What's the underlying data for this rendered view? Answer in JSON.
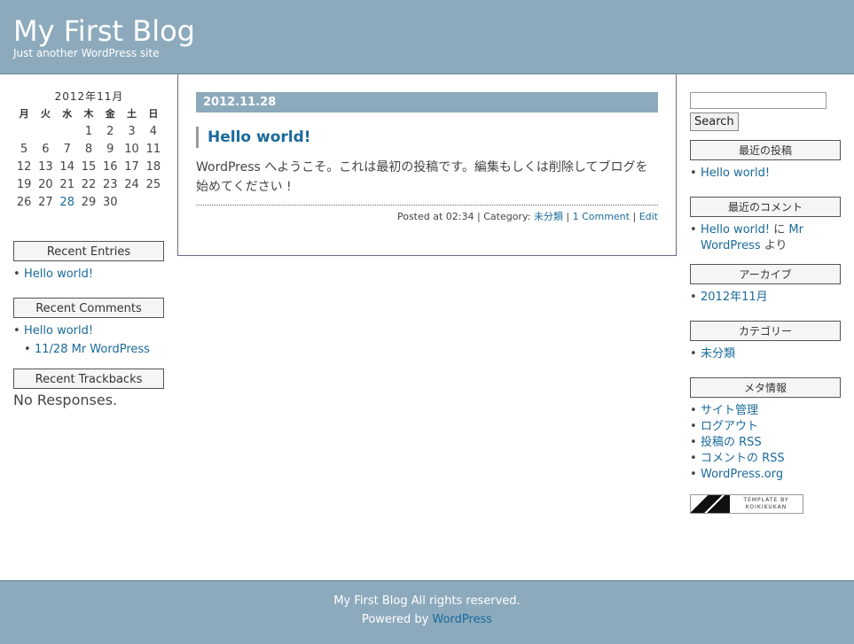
{
  "header": {
    "title": "My First Blog",
    "description": "Just another WordPress site"
  },
  "calendar": {
    "caption": "2012年11月",
    "weekdays": [
      "月",
      "火",
      "水",
      "木",
      "金",
      "土",
      "日"
    ],
    "weeks": [
      [
        "",
        "",
        "",
        "1",
        "2",
        "3",
        "4"
      ],
      [
        "5",
        "6",
        "7",
        "8",
        "9",
        "10",
        "11"
      ],
      [
        "12",
        "13",
        "14",
        "15",
        "16",
        "17",
        "18"
      ],
      [
        "19",
        "20",
        "21",
        "22",
        "23",
        "24",
        "25"
      ],
      [
        "26",
        "27",
        "28",
        "29",
        "30",
        "",
        ""
      ]
    ],
    "linked_day": "28"
  },
  "left_sidebar": {
    "recent_entries": {
      "title": "Recent Entries",
      "items": [
        "Hello world!"
      ]
    },
    "recent_comments": {
      "title": "Recent Comments",
      "post": "Hello world!",
      "sub": "11/28 Mr WordPress"
    },
    "recent_trackbacks": {
      "title": "Recent Trackbacks",
      "text": "No Responses."
    }
  },
  "post": {
    "date": "2012.11.28",
    "title": "Hello world!",
    "body": "WordPress へようこそ。これは最初の投稿です。編集もしくは削除してブログを始めてください !",
    "meta": {
      "posted_at": "Posted at 02:34",
      "category_label": "Category:",
      "category": "未分類",
      "comments": "1 Comment",
      "edit": "Edit",
      "sep": "|"
    }
  },
  "right_sidebar": {
    "search": {
      "placeholder": "",
      "button": "Search"
    },
    "recent_posts": {
      "title": "最近の投稿",
      "items": [
        "Hello world!"
      ]
    },
    "recent_comments": {
      "title": "最近のコメント",
      "link1": "Hello world!",
      "connector": " に ",
      "link2": "Mr WordPress",
      "suffix": " より"
    },
    "archives": {
      "title": "アーカイブ",
      "items": [
        "2012年11月"
      ]
    },
    "categories": {
      "title": "カテゴリー",
      "items": [
        "未分類"
      ]
    },
    "meta": {
      "title": "メタ情報",
      "items": [
        "サイト管理",
        "ログアウト",
        "投稿の RSS",
        "コメントの RSS",
        "WordPress.org"
      ]
    },
    "badge": {
      "line1": "TEMPLATE BY",
      "line2": "KOIKIKUKAN"
    }
  },
  "footer": {
    "rights": "My First Blog All rights reserved.",
    "powered_prefix": "Powered by ",
    "powered_link": "WordPress"
  }
}
